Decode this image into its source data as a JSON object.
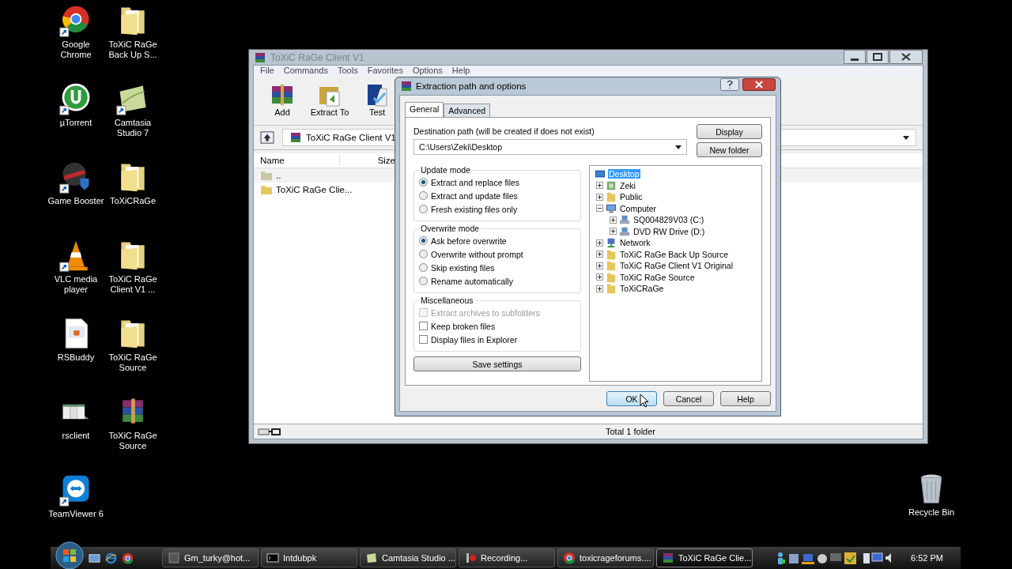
{
  "desktop_icons": [
    {
      "label": "Google Chrome",
      "kind": "chrome",
      "shortcut": true
    },
    {
      "label": "ToXiC RaGe Back Up S...",
      "kind": "folder",
      "shortcut": false
    },
    {
      "label": "µTorrent",
      "kind": "utorrent",
      "shortcut": true
    },
    {
      "label": "Camtasia Studio 7",
      "kind": "camtasia",
      "shortcut": true
    },
    {
      "label": "Game Booster",
      "kind": "gamebooster",
      "shortcut": true
    },
    {
      "label": "ToXiCRaGe",
      "kind": "folder",
      "shortcut": false
    },
    {
      "label": "VLC media player",
      "kind": "vlc",
      "shortcut": true
    },
    {
      "label": "ToXiC RaGe Client V1 ...",
      "kind": "folder",
      "shortcut": false
    },
    {
      "label": "RSBuddy",
      "kind": "java",
      "shortcut": false
    },
    {
      "label": "ToXiC RaGe Source",
      "kind": "folder",
      "shortcut": false
    },
    {
      "label": "rsclient",
      "kind": "rsclient",
      "shortcut": false
    },
    {
      "label": "ToXiC RaGe Source",
      "kind": "winrar",
      "shortcut": false
    },
    {
      "label": "TeamViewer 6",
      "kind": "teamviewer",
      "shortcut": true
    }
  ],
  "recycle_bin": {
    "label": "Recycle Bin"
  },
  "winrar_window": {
    "title": "ToXiC RaGe Client V1",
    "menu": [
      "File",
      "Commands",
      "Tools",
      "Favorites",
      "Options",
      "Help"
    ],
    "toolbar": [
      {
        "label": "Add",
        "kind": "add"
      },
      {
        "label": "Extract To",
        "kind": "extract"
      },
      {
        "label": "Test",
        "kind": "test"
      }
    ],
    "address": "ToXiC RaGe Client V1",
    "columns": [
      "Name",
      "Size"
    ],
    "rows": [
      {
        "name": "..",
        "kind": "up"
      },
      {
        "name": "ToXiC RaGe Clie...",
        "kind": "folder"
      }
    ],
    "status_bar": "Total 1 folder"
  },
  "dialog": {
    "title": "Extraction path and options",
    "tabs": [
      {
        "label": "General",
        "selected": true
      },
      {
        "label": "Advanced",
        "selected": false
      }
    ],
    "destination_label": "Destination path (will be created if does not exist)",
    "destination_path": "C:\\Users\\Zeki\\Desktop",
    "side_buttons": [
      "Display",
      "New folder"
    ],
    "update_mode": {
      "title": "Update mode",
      "options": [
        {
          "label": "Extract and replace files",
          "selected": true
        },
        {
          "label": "Extract and update files",
          "selected": false
        },
        {
          "label": "Fresh existing files only",
          "selected": false
        }
      ]
    },
    "overwrite_mode": {
      "title": "Overwrite mode",
      "options": [
        {
          "label": "Ask before overwrite",
          "selected": true
        },
        {
          "label": "Overwrite without prompt",
          "selected": false
        },
        {
          "label": "Skip existing files",
          "selected": false
        },
        {
          "label": "Rename automatically",
          "selected": false
        }
      ]
    },
    "miscellaneous": {
      "title": "Miscellaneous",
      "options": [
        {
          "label": "Extract archives to subfolders",
          "checked": false,
          "disabled": true
        },
        {
          "label": "Keep broken files",
          "checked": false,
          "disabled": false
        },
        {
          "label": "Display files in Explorer",
          "checked": false,
          "disabled": false
        }
      ]
    },
    "save_button": "Save settings",
    "tree": [
      {
        "label": "Desktop",
        "kind": "desktop",
        "selected": true,
        "children": [
          {
            "label": "Zeki",
            "kind": "user",
            "expanded": false,
            "selected": false
          },
          {
            "label": "Public",
            "kind": "folder",
            "expanded": false,
            "selected": false
          },
          {
            "label": "Computer",
            "kind": "computer",
            "expanded": true,
            "selected": false,
            "children": [
              {
                "label": "SQ004829V03 (C:)",
                "kind": "drive",
                "expanded": false,
                "selected": false
              },
              {
                "label": "DVD RW Drive (D:)",
                "kind": "drive",
                "expanded": false,
                "selected": false
              }
            ]
          },
          {
            "label": "Network",
            "kind": "network",
            "expanded": false,
            "selected": false
          },
          {
            "label": "ToXiC RaGe Back Up Source",
            "kind": "folder",
            "expanded": false,
            "selected": false
          },
          {
            "label": "ToXiC RaGe Client V1 Original",
            "kind": "folder",
            "expanded": false,
            "selected": false
          },
          {
            "label": "ToXiC RaGe Source",
            "kind": "folder",
            "expanded": false,
            "selected": false
          },
          {
            "label": "ToXiCRaGe",
            "kind": "folder",
            "expanded": false,
            "selected": false
          }
        ]
      }
    ],
    "buttons": [
      {
        "label": "OK",
        "default": true
      },
      {
        "label": "Cancel",
        "default": false
      },
      {
        "label": "Help",
        "default": false
      }
    ]
  },
  "taskbar": {
    "tasks": [
      {
        "label": "Gm_turky@hot...",
        "kind": "chat",
        "selected": false
      },
      {
        "label": "Intdubpk",
        "kind": "console",
        "selected": false
      },
      {
        "label": "Camtasia Studio ...",
        "kind": "camtasia",
        "selected": false
      },
      {
        "label": "Recording...",
        "kind": "record",
        "selected": false
      },
      {
        "label": "toxicrageforums....",
        "kind": "chrome",
        "selected": false
      },
      {
        "label": "ToXiC RaGe Clie...",
        "kind": "winrar",
        "selected": true
      }
    ],
    "clock": "6:52 PM"
  }
}
